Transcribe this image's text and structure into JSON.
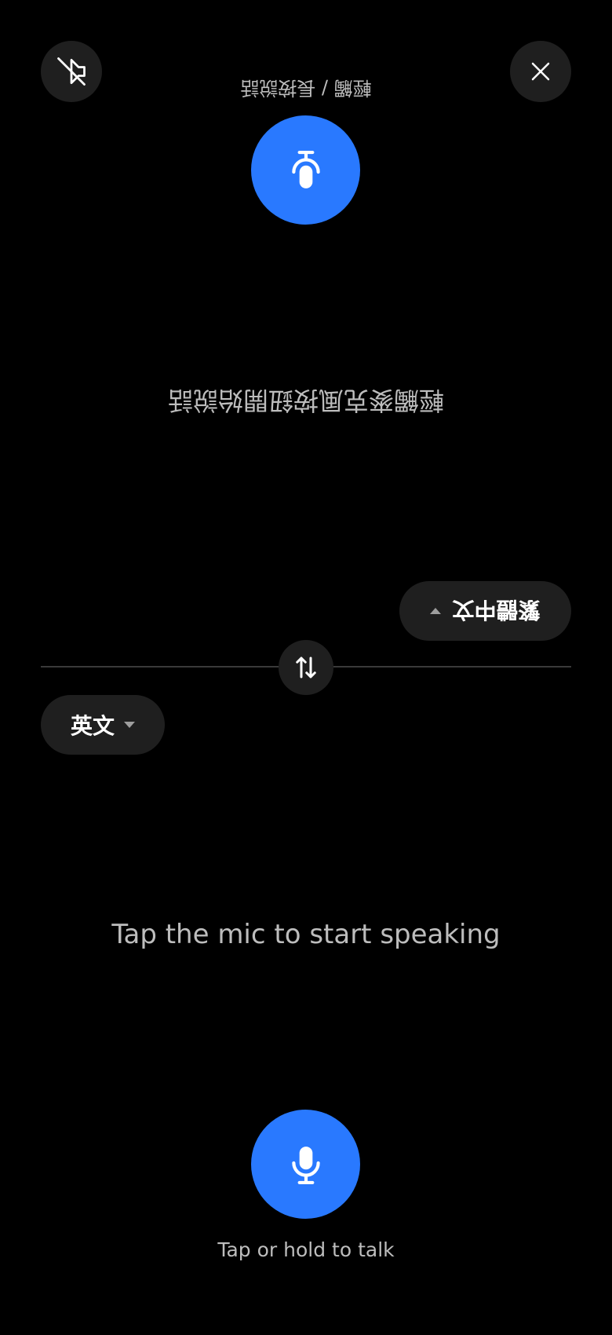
{
  "colors": {
    "background": "#000000",
    "button_dark": "#1f1f1f",
    "mic_blue": "#2979ff",
    "text_primary": "#ffffff",
    "text_secondary": "#bdbdbd",
    "divider": "#3a3a3a"
  },
  "icons": {
    "mute": "volume-off-icon",
    "close": "close-icon",
    "mic": "microphone-icon",
    "swap": "swap-vertical-icon",
    "caret": "caret-down-icon"
  },
  "top_panel": {
    "hint": "輕觸 / 長按說話",
    "prompt": "輕觸麥克風按鈕開始說話",
    "language": "繁體中文"
  },
  "bottom_panel": {
    "language": "英文",
    "prompt": "Tap the mic to start speaking",
    "hint": "Tap or hold to talk"
  }
}
